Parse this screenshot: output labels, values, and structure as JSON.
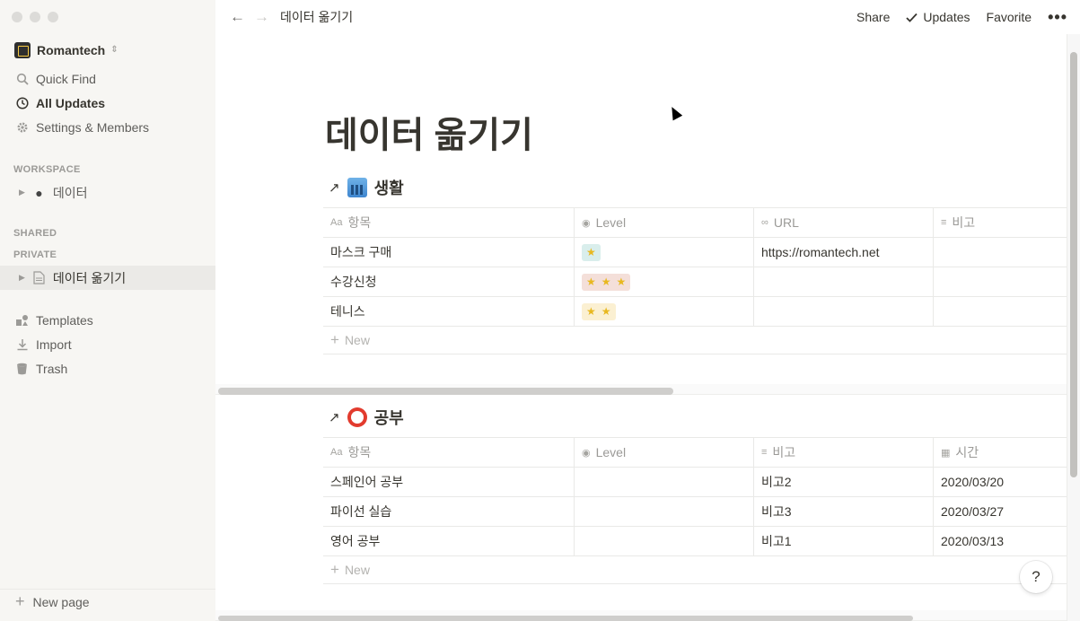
{
  "workspace": {
    "name": "Romantech"
  },
  "sidebar": {
    "top_items": [
      {
        "label": "Quick Find",
        "icon": "search-icon"
      },
      {
        "label": "All Updates",
        "icon": "clock-icon"
      },
      {
        "label": "Settings & Members",
        "icon": "gear-icon"
      }
    ],
    "workspace_label": "WORKSPACE",
    "workspace_page": "데이터",
    "shared_label": "SHARED",
    "private_label": "PRIVATE",
    "private_page": "데이터 옮기기",
    "bottom_items": [
      {
        "label": "Templates",
        "icon": "templates-icon"
      },
      {
        "label": "Import",
        "icon": "import-icon"
      },
      {
        "label": "Trash",
        "icon": "trash-icon"
      }
    ],
    "new_page": "New page"
  },
  "topbar": {
    "breadcrumb": "데이터 옮기기",
    "share": "Share",
    "updates": "Updates",
    "favorite": "Favorite",
    "more": "•••"
  },
  "page": {
    "title": "데이터 옮기기",
    "databases": [
      {
        "title": "생활",
        "icon": "cityscape-emoji",
        "columns": [
          "항목",
          "Level",
          "URL",
          "비고"
        ],
        "rows": [
          {
            "name": "마스크 구매",
            "level_stars": 1,
            "url": "https://romantech.net",
            "note": ""
          },
          {
            "name": "수강신청",
            "level_stars": 3,
            "url": "",
            "note": ""
          },
          {
            "name": "테니스",
            "level_stars": 2,
            "url": "",
            "note": ""
          }
        ],
        "new_label": "New"
      },
      {
        "title": "공부",
        "icon": "alarm-clock-emoji",
        "columns": [
          "항목",
          "Level",
          "비고",
          "시간"
        ],
        "rows": [
          {
            "name": "스페인어 공부",
            "level": "",
            "note": "비고2",
            "date": "2020/03/20"
          },
          {
            "name": "파이선 실습",
            "level": "",
            "note": "비고3",
            "date": "2020/03/27"
          },
          {
            "name": "영어 공부",
            "level": "",
            "note": "비고1",
            "date": "2020/03/13"
          }
        ],
        "new_label": "New"
      }
    ]
  },
  "help": "?",
  "colors": {
    "sidebar_bg": "#f7f6f3",
    "text": "#37352f",
    "muted": "#9b9a97",
    "star": "#e8b820"
  }
}
